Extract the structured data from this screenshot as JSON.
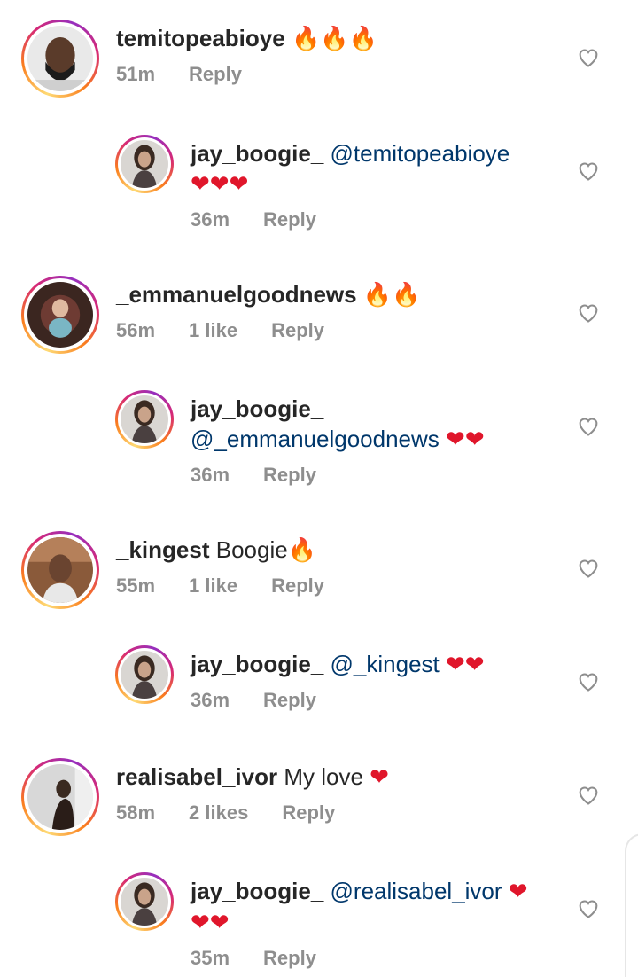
{
  "comments": [
    {
      "username": "temitopeabioye",
      "text": "",
      "emoji": "🔥🔥🔥",
      "time": "51m",
      "likes": "",
      "reply_label": "Reply",
      "replies": [
        {
          "username": "jay_boogie_",
          "mention": "@temitopeabioye",
          "emoji": "❤❤❤",
          "time": "36m",
          "reply_label": "Reply"
        }
      ]
    },
    {
      "username": "_emmanuelgoodnews",
      "text": "",
      "emoji": "🔥🔥",
      "time": "56m",
      "likes": "1 like",
      "reply_label": "Reply",
      "replies": [
        {
          "username": "jay_boogie_",
          "mention": "@_emmanuelgoodnews",
          "emoji": "❤❤",
          "time": "36m",
          "reply_label": "Reply"
        }
      ]
    },
    {
      "username": "_kingest",
      "text": "Boogie",
      "emoji": "🔥",
      "time": "55m",
      "likes": "1 like",
      "reply_label": "Reply",
      "replies": [
        {
          "username": "jay_boogie_",
          "mention": "@_kingest",
          "emoji": "❤❤",
          "time": "36m",
          "reply_label": "Reply"
        }
      ]
    },
    {
      "username": "realisabel_ivor",
      "text": "My love",
      "emoji": "❤",
      "time": "58m",
      "likes": "2 likes",
      "reply_label": "Reply",
      "replies": [
        {
          "username": "jay_boogie_",
          "mention": "@realisabel_ivor",
          "emoji": "❤❤❤",
          "time": "35m",
          "reply_label": "Reply"
        }
      ]
    }
  ],
  "icons": {
    "like": "heart-outline-icon"
  },
  "colors": {
    "mention": "#00376b",
    "meta": "#8e8e8e",
    "heart": "#e0162b"
  }
}
